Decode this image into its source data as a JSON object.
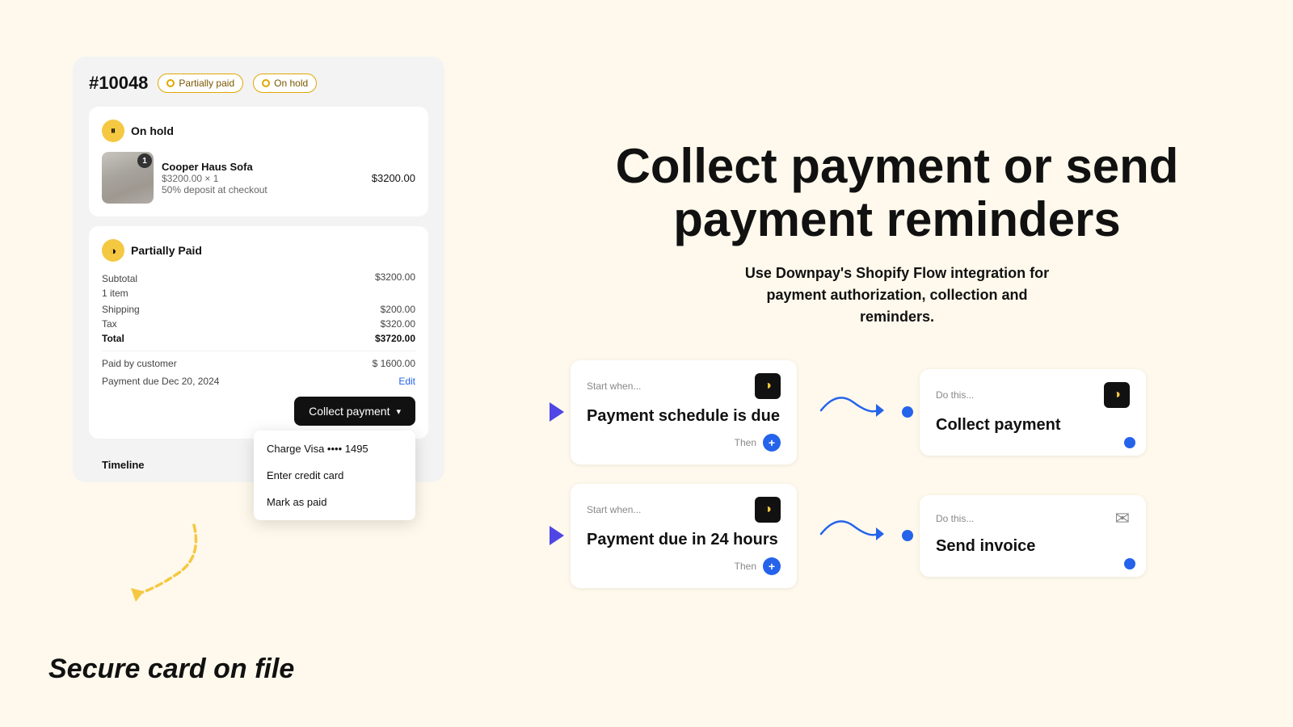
{
  "left": {
    "order_number": "#10048",
    "badges": [
      {
        "label": "Partially paid"
      },
      {
        "label": "On hold"
      }
    ],
    "on_hold_section": {
      "title": "On hold",
      "product": {
        "name": "Cooper Haus Sofa",
        "price_detail": "$3200.00 × 1",
        "deposit": "50% deposit at checkout",
        "price": "$3200.00",
        "qty_badge": "1"
      }
    },
    "partially_paid_section": {
      "title": "Partially Paid",
      "subtotal_label": "Subtotal",
      "subtotal_sub": "1 item",
      "subtotal_value": "$3200.00",
      "shipping_label": "Shipping",
      "shipping_value": "$200.00",
      "tax_label": "Tax",
      "tax_value": "$320.00",
      "total_label": "Total",
      "total_value": "$3720.00",
      "paid_label": "Paid by customer",
      "paid_value": "$ 1600.00",
      "due_label": "Payment due Dec 20, 2024",
      "edit_label": "Edit"
    },
    "collect_btn": "Collect payment",
    "dropdown": {
      "items": [
        "Charge Visa •••• 1495",
        "Enter credit card",
        "Mark as paid"
      ]
    },
    "timeline_title": "Timeline",
    "secure_card_label": "Secure card on file"
  },
  "right": {
    "headline_line1": "Collect payment or send",
    "headline_line2": "payment reminders",
    "subheadline": "Use Downpay's Shopify Flow integration for\npayment authorization, collection and\nreminders.",
    "flow_row1": {
      "start_card": {
        "label": "Start when...",
        "title": "Payment schedule is due",
        "then_label": "Then"
      },
      "action_card": {
        "label": "Do this...",
        "title": "Collect payment"
      }
    },
    "flow_row2": {
      "start_card": {
        "label": "Start when...",
        "title": "Payment due in 24 hours",
        "then_label": "Then"
      },
      "action_card": {
        "label": "Do this...",
        "title": "Send invoice"
      }
    }
  }
}
